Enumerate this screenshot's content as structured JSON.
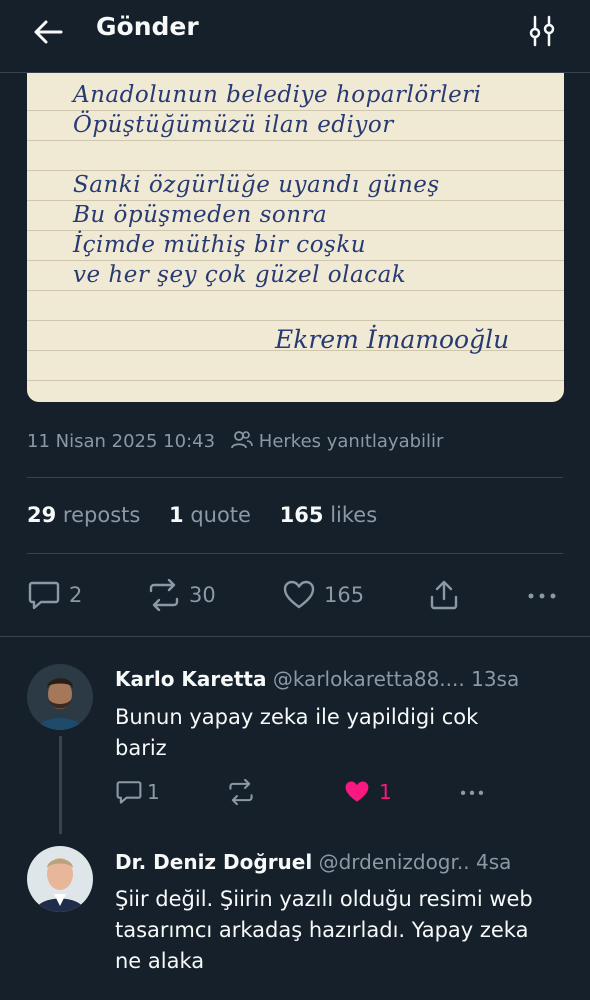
{
  "header": {
    "title": "Gönder",
    "back_icon": "arrow-left-icon",
    "settings_icon": "sliders-icon"
  },
  "note": {
    "lines": [
      "Anadolunun belediye hoparlörleri",
      "Öpüştüğümüzü ilan ediyor",
      "",
      "Sanki özgürlüğe uyandı güneş",
      "Bu öpüşmeden sonra",
      "İçimde müthiş bir coşku",
      "ve her şey çok güzel olacak"
    ],
    "signature": "Ekrem İmamooğlu"
  },
  "tweet": {
    "timestamp": "11 Nisan 2025 10:43",
    "audience": "Herkes yanıtlayabilir",
    "reposts_count": "29",
    "reposts_label": "reposts",
    "quotes_count": "1",
    "quotes_label": "quote",
    "likes_count": "165",
    "likes_label": "likes",
    "actions": {
      "replies": "2",
      "retweets": "30",
      "likes": "165"
    }
  },
  "replies": [
    {
      "name": "Karlo Karetta",
      "handle": "@karlokaretta88....",
      "time": "13sa",
      "text": "Bunun yapay zeka ile yapildigi cok bariz",
      "reply_count": "1",
      "like_count": "1"
    },
    {
      "name": "Dr. Deniz Doğruel",
      "handle": "@drdenizdogr..",
      "time": "4sa",
      "text": "Şiir değil. Şiirin yazılı olduğu resimi web tasarımcı arkadaş hazırladı. Yapay zeka ne alaka"
    }
  ],
  "colors": {
    "background": "#15202b",
    "muted": "#8b98a5",
    "divider": "#38444d",
    "like_pink": "#f91880",
    "ink": "#283a73",
    "paper": "#f0ead4"
  }
}
